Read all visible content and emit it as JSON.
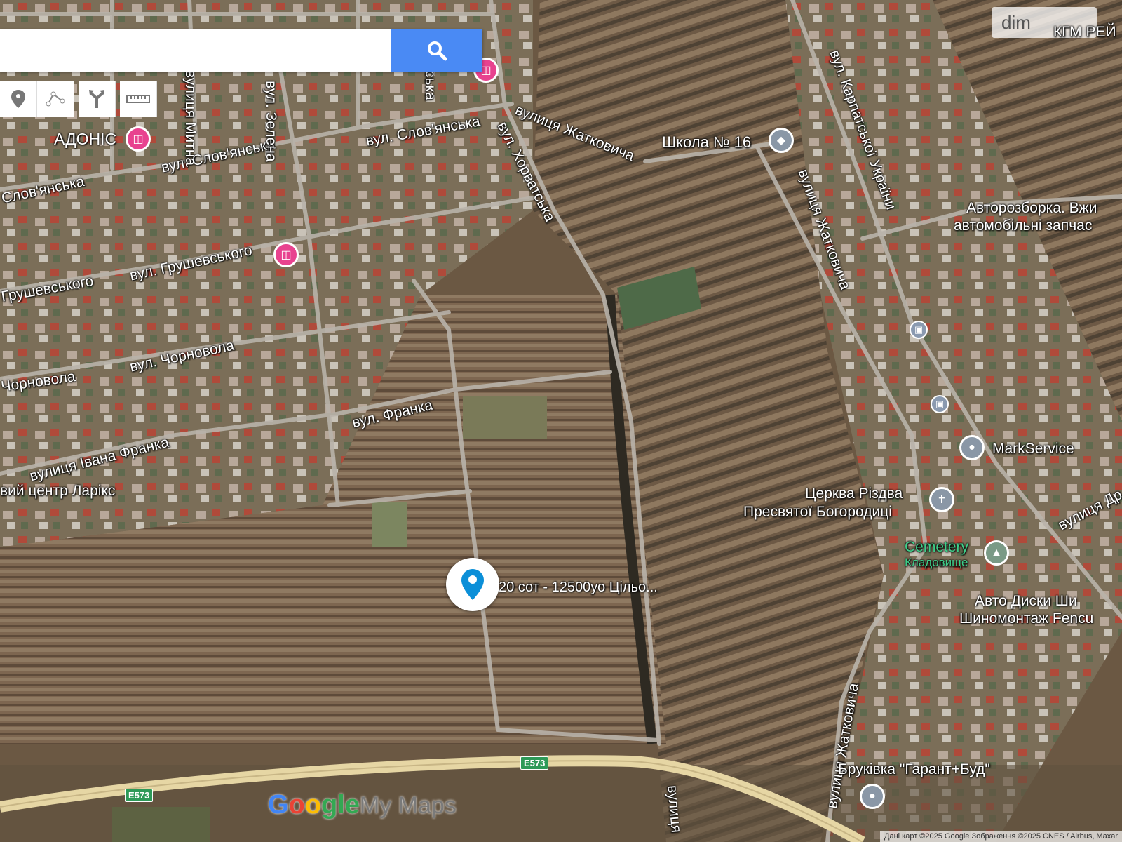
{
  "search": {
    "placeholder": ""
  },
  "toolbar": {
    "tools": [
      "marker-icon",
      "line-icon",
      "directions-icon",
      "ruler-icon"
    ]
  },
  "watermark": {
    "text": "dim",
    "partial_label": "КГМ РЕЙ"
  },
  "streets": [
    "вул. Слов'янська",
    "вул. Слов'янська",
    "Слов'янська",
    "вулиця Жатковича",
    "вул. Хорватська",
    "вул. Зелена",
    "вулиця Митна",
    "вул. Грушевського",
    "Грушевського",
    "вул. Чорновола",
    "Чорновола",
    "вул. Франка",
    "вулиця Івана Франка",
    "вул. Карпатської України",
    "вулиця Жатковича",
    "вулиця Жатковича",
    "вулиця Др",
    "вулиця",
    "вулиця",
    "ська"
  ],
  "places": {
    "adonis": "АДОНІС",
    "school": "Школа № 16",
    "autoparts_line1": "Авторозборка. Вжи",
    "autoparts_line2": "автомобільні запчас",
    "markservice": "MarkService",
    "church_line1": "Церква Різдва",
    "church_line2": "Пресвятої Богородиці",
    "cemetery_line1": "Cemetery",
    "cemetery_line2": "Кладовище",
    "tires_line1": "Авто Диски Ши",
    "tires_line2": "Шиномонтаж Fencu",
    "brukivka": "Бруківка \"Гарант+Буд\"",
    "larix": "вий центр Ларікс",
    "pin_label": "20 сот - 12500уо Цільо..."
  },
  "highway": {
    "shield_1": "E573",
    "shield_2": "E573"
  },
  "logo": {
    "g1": "G",
    "g2": "o",
    "g3": "o",
    "g4": "gle",
    "mm": "My Maps"
  },
  "attribution": "Дані карт ©2025 Google Зображення ©2025 CNES / Airbus, Maxar"
}
